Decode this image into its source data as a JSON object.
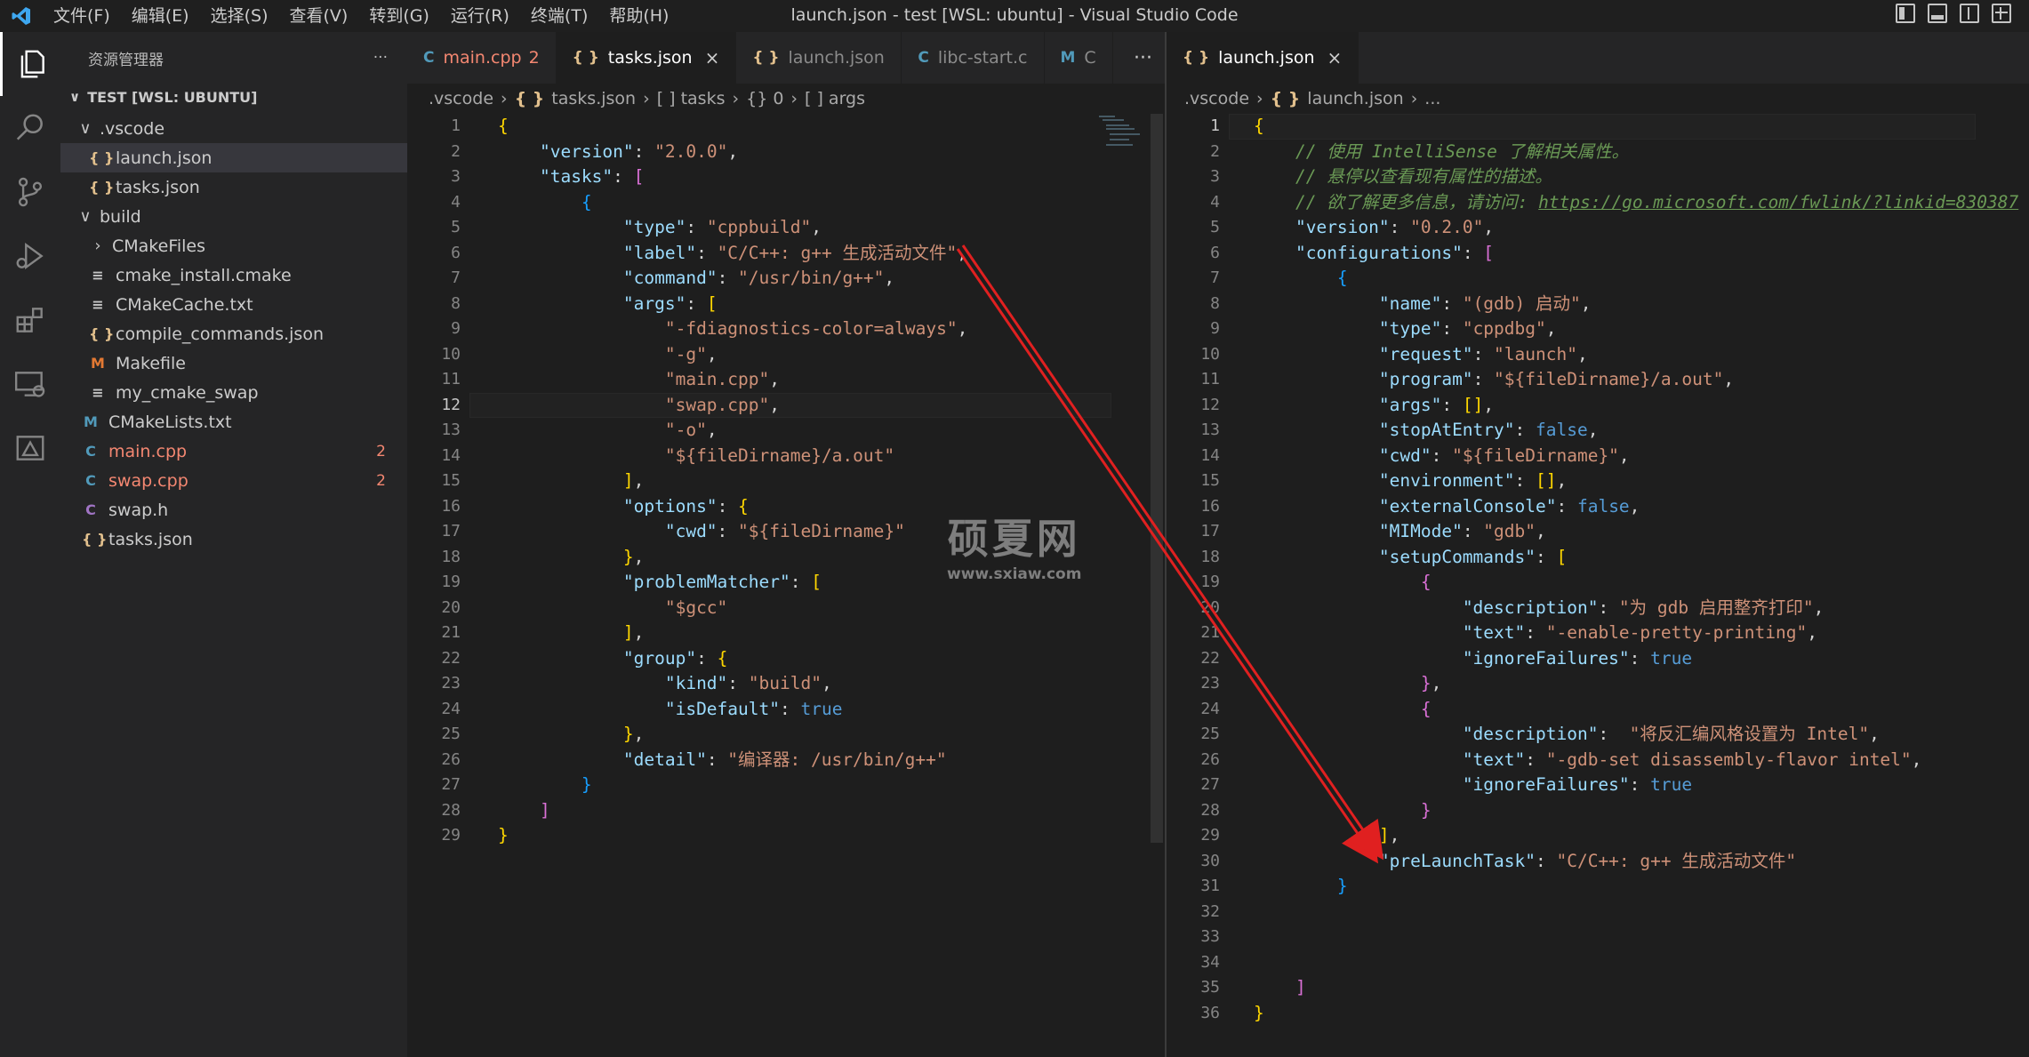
{
  "titlebar": {
    "menu": [
      "文件(F)",
      "编辑(E)",
      "选择(S)",
      "查看(V)",
      "转到(G)",
      "运行(R)",
      "终端(T)",
      "帮助(H)"
    ],
    "window_title": "launch.json - test [WSL: ubuntu] - Visual Studio Code"
  },
  "sidebar": {
    "title": "资源管理器",
    "more": "···",
    "section": "TEST [WSL: UBUNTU]",
    "items": [
      {
        "label": ".vscode",
        "kind": "folder-open",
        "depth": 1
      },
      {
        "label": "launch.json",
        "kind": "json",
        "depth": 2,
        "selected": true
      },
      {
        "label": "tasks.json",
        "kind": "json",
        "depth": 2
      },
      {
        "label": "build",
        "kind": "folder-open",
        "depth": 1
      },
      {
        "label": "CMakeFiles",
        "kind": "folder-closed",
        "depth": 2
      },
      {
        "label": "cmake_install.cmake",
        "kind": "lines",
        "depth": 2
      },
      {
        "label": "CMakeCache.txt",
        "kind": "lines",
        "depth": 2
      },
      {
        "label": "compile_commands.json",
        "kind": "json",
        "depth": 2
      },
      {
        "label": "Makefile",
        "kind": "makefile",
        "depth": 2
      },
      {
        "label": "my_cmake_swap",
        "kind": "lines",
        "depth": 2
      },
      {
        "label": "CMakeLists.txt",
        "kind": "cmake",
        "depth": 1
      },
      {
        "label": "main.cpp",
        "kind": "cpp",
        "depth": 1,
        "badge": "2",
        "error": true
      },
      {
        "label": "swap.cpp",
        "kind": "cpp",
        "depth": 1,
        "badge": "2",
        "error": true
      },
      {
        "label": "swap.h",
        "kind": "c",
        "depth": 1
      },
      {
        "label": "tasks.json",
        "kind": "json",
        "depth": 1
      }
    ]
  },
  "group1": {
    "tabs": [
      {
        "label": "main.cpp",
        "icon": "C++",
        "count": "2",
        "error": true
      },
      {
        "label": "tasks.json",
        "icon": "{}",
        "active": true,
        "close": "×"
      },
      {
        "label": "launch.json",
        "icon": "{}"
      },
      {
        "label": "libc-start.c",
        "icon": "C"
      },
      {
        "label": "C",
        "icon": "M"
      }
    ],
    "more": "···",
    "breadcrumb": [
      ".vscode",
      "tasks.json",
      "[ ] tasks",
      "{} 0",
      "[ ] args"
    ],
    "current_line": 12
  },
  "group2": {
    "tabs": [
      {
        "label": "launch.json",
        "icon": "{}",
        "active": true,
        "close": "×"
      }
    ],
    "breadcrumb": [
      ".vscode",
      "launch.json",
      "..."
    ],
    "current_line": 1
  },
  "tasks_json_lines": [
    "{",
    "    \"version\": \"2.0.0\",",
    "    \"tasks\": [",
    "        {",
    "            \"type\": \"cppbuild\",",
    "            \"label\": \"C/C++: g++ 生成活动文件\",",
    "            \"command\": \"/usr/bin/g++\",",
    "            \"args\": [",
    "                \"-fdiagnostics-color=always\",",
    "                \"-g\",",
    "                \"main.cpp\",",
    "                \"swap.cpp\",",
    "                \"-o\",",
    "                \"${fileDirname}/a.out\"",
    "            ],",
    "            \"options\": {",
    "                \"cwd\": \"${fileDirname}\"",
    "            },",
    "            \"problemMatcher\": [",
    "                \"$gcc\"",
    "            ],",
    "            \"group\": {",
    "                \"kind\": \"build\",",
    "                \"isDefault\": true",
    "            },",
    "            \"detail\": \"编译器: /usr/bin/g++\"",
    "        }",
    "    ]",
    "}"
  ],
  "launch_json_lines": [
    "{",
    "    // 使用 IntelliSense 了解相关属性。",
    "    // 悬停以查看现有属性的描述。",
    "    // 欲了解更多信息，请访问: https://go.microsoft.com/fwlink/?linkid=830387",
    "    \"version\": \"0.2.0\",",
    "    \"configurations\": [",
    "        {",
    "            \"name\": \"(gdb) 启动\",",
    "            \"type\": \"cppdbg\",",
    "            \"request\": \"launch\",",
    "            \"program\": \"${fileDirname}/a.out\",",
    "            \"args\": [],",
    "            \"stopAtEntry\": false,",
    "            \"cwd\": \"${fileDirname}\",",
    "            \"environment\": [],",
    "            \"externalConsole\": false,",
    "            \"MIMode\": \"gdb\",",
    "            \"setupCommands\": [",
    "                {",
    "                    \"description\": \"为 gdb 启用整齐打印\",",
    "                    \"text\": \"-enable-pretty-printing\",",
    "                    \"ignoreFailures\": true",
    "                },",
    "                {",
    "                    \"description\":  \"将反汇编风格设置为 Intel\",",
    "                    \"text\": \"-gdb-set disassembly-flavor intel\",",
    "                    \"ignoreFailures\": true",
    "                }",
    "            ],",
    "            \"preLaunchTask\": \"C/C++: g++ 生成活动文件\"",
    "        }",
    "",
    "",
    "",
    "    ]",
    "}"
  ],
  "watermark": {
    "main": "硕夏网",
    "sub": "www.sxiaw.com"
  },
  "colors": {
    "background": "#1e1e1e",
    "sidebar": "#252526",
    "key": "#9cdcfe",
    "string": "#ce9178",
    "keyword": "#569cd6",
    "comment": "#6a9955",
    "error": "#f48771",
    "json_icon": "#e2c08d",
    "arrow": "#e02020"
  }
}
